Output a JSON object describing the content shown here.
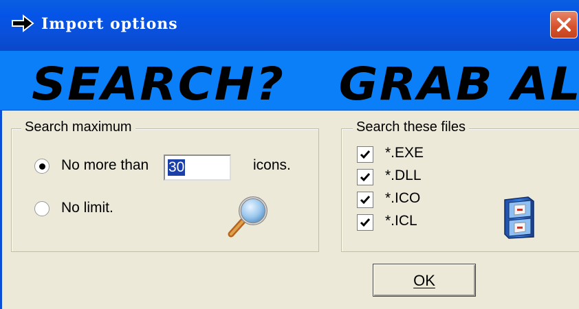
{
  "window": {
    "title": "Import options",
    "close_label": "×"
  },
  "banner": {
    "text": "SEARCH?   GRAB ALL !!"
  },
  "search_max": {
    "group_label": "Search maximum",
    "option_limit_label": "No more than",
    "option_limit_selected": true,
    "limit_value": "30",
    "limit_unit": "icons.",
    "option_nolimit_label": "No limit.",
    "option_nolimit_selected": false
  },
  "search_files": {
    "group_label": "Search these files",
    "items": [
      {
        "label": "*.EXE",
        "checked": true
      },
      {
        "label": "*.DLL",
        "checked": true
      },
      {
        "label": "*.ICO",
        "checked": true
      },
      {
        "label": "*.ICL",
        "checked": true
      }
    ]
  },
  "ok_button": {
    "label": "OK"
  },
  "colors": {
    "title_bar": "#0554e8",
    "banner": "#0a7ff7",
    "dialog_bg": "#ece9d8",
    "close_button": "#d8542e"
  },
  "icons": {
    "title_icon": "right-arrow-icon",
    "search_icon": "magnifier-icon",
    "files_icon": "file-cabinet-icon"
  }
}
